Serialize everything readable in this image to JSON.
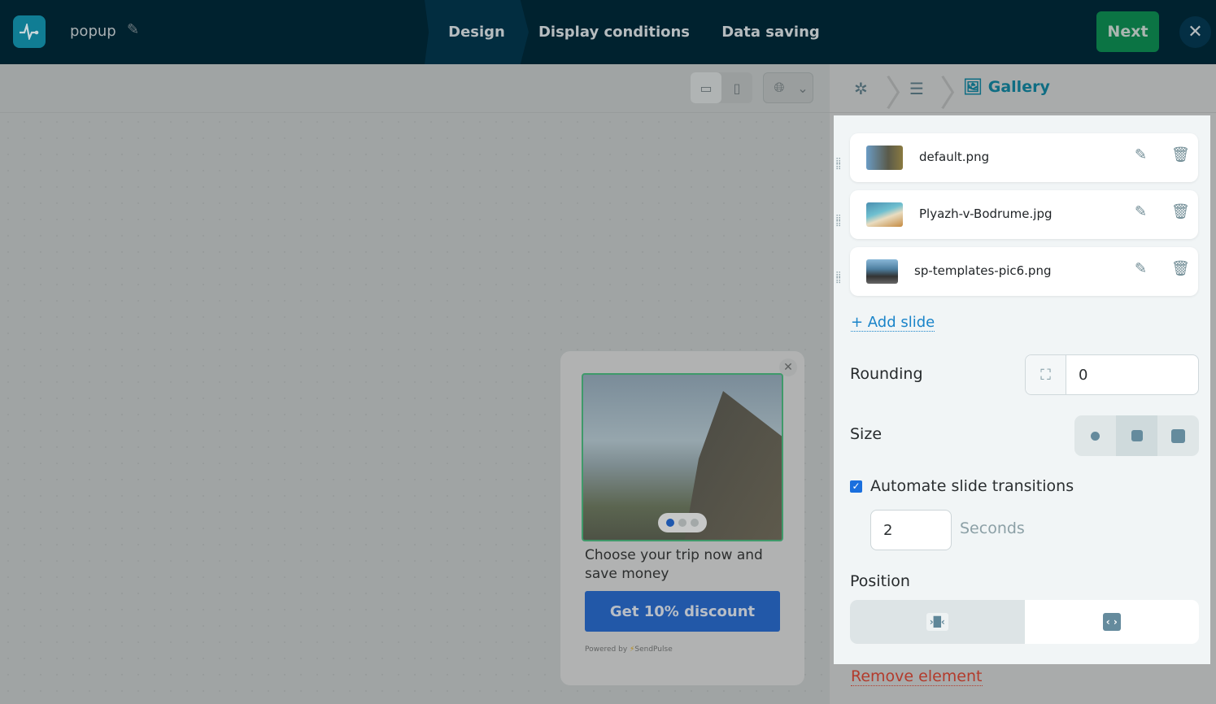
{
  "header": {
    "title": "popup",
    "steps": [
      "Design",
      "Display conditions",
      "Data saving"
    ],
    "next_label": "Next"
  },
  "popup": {
    "text": "Choose your trip now and save money",
    "button": "Get 10% discount",
    "powered": "Powered by",
    "brand": "SendPulse",
    "active_slide": 1,
    "slide_count": 3
  },
  "panel": {
    "breadcrumb_current": "Gallery",
    "slides": [
      {
        "name": "default.png"
      },
      {
        "name": "Plyazh-v-Bodrume.jpg"
      },
      {
        "name": "sp-templates-pic6.png"
      }
    ],
    "add_slide": "+ Add slide",
    "rounding_label": "Rounding",
    "rounding_value": "0",
    "size_label": "Size",
    "automate_label": "Automate slide transitions",
    "automate_checked": true,
    "seconds_value": "2",
    "seconds_label": "Seconds",
    "position_label": "Position",
    "remove_label": "Remove element"
  },
  "colors": {
    "accent": "#0f6d83",
    "next": "#0b7444",
    "danger": "#b33b2c"
  }
}
